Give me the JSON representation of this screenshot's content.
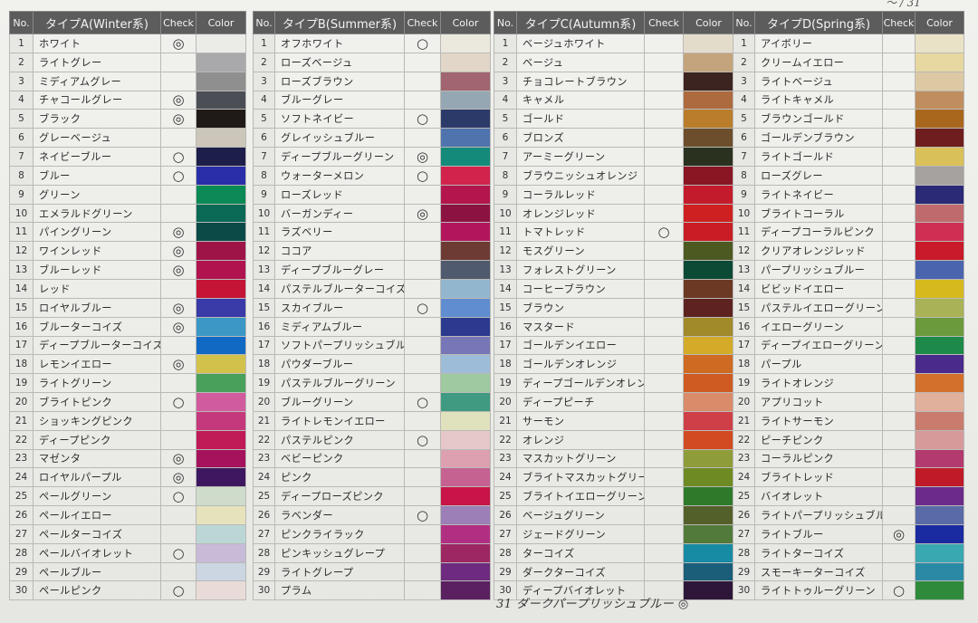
{
  "headers": {
    "no": "No.",
    "check": "Check",
    "color": "Color"
  },
  "tables": [
    {
      "title": "タイプA(Winter系)",
      "rows": [
        {
          "no": "1",
          "name": "ホワイト",
          "check": "◎",
          "color": "#ebebe8"
        },
        {
          "no": "2",
          "name": "ライトグレー",
          "check": "",
          "color": "#a9a9ab"
        },
        {
          "no": "3",
          "name": "ミディアムグレー",
          "check": "",
          "color": "#8f8f90"
        },
        {
          "no": "4",
          "name": "チャコールグレー",
          "check": "◎",
          "color": "#4b4e55"
        },
        {
          "no": "5",
          "name": "ブラック",
          "check": "◎",
          "color": "#1f1a18"
        },
        {
          "no": "6",
          "name": "グレーベージュ",
          "check": "",
          "color": "#cbc6b9"
        },
        {
          "no": "7",
          "name": "ネイビーブルー",
          "check": "○",
          "color": "#1d1e4a"
        },
        {
          "no": "8",
          "name": "ブルー",
          "check": "○",
          "color": "#2a2ea8"
        },
        {
          "no": "9",
          "name": "グリーン",
          "check": "",
          "color": "#0b8a55"
        },
        {
          "no": "10",
          "name": "エメラルドグリーン",
          "check": "",
          "color": "#0a6a55"
        },
        {
          "no": "11",
          "name": "パイングリーン",
          "check": "◎",
          "color": "#0a4a47"
        },
        {
          "no": "12",
          "name": "ワインレッド",
          "check": "◎",
          "color": "#9e1447"
        },
        {
          "no": "13",
          "name": "ブルーレッド",
          "check": "◎",
          "color": "#b0134e"
        },
        {
          "no": "14",
          "name": "レッド",
          "check": "",
          "color": "#c41536"
        },
        {
          "no": "15",
          "name": "ロイヤルブルー",
          "check": "◎",
          "color": "#3a3aa8"
        },
        {
          "no": "16",
          "name": "ブルーターコイズ",
          "check": "◎",
          "color": "#3b98c6"
        },
        {
          "no": "17",
          "name": "ディープブルーターコイズ",
          "check": "",
          "color": "#1269c4"
        },
        {
          "no": "18",
          "name": "レモンイエロー",
          "check": "◎",
          "color": "#d2c24c"
        },
        {
          "no": "19",
          "name": "ライトグリーン",
          "check": "",
          "color": "#49a05a"
        },
        {
          "no": "20",
          "name": "ブライトピンク",
          "check": "○",
          "color": "#d05c9e"
        },
        {
          "no": "21",
          "name": "ショッキングピンク",
          "check": "",
          "color": "#c4397b"
        },
        {
          "no": "22",
          "name": "ディープピンク",
          "check": "",
          "color": "#c01a57"
        },
        {
          "no": "23",
          "name": "マゼンタ",
          "check": "◎",
          "color": "#a4135c"
        },
        {
          "no": "24",
          "name": "ロイヤルパープル",
          "check": "◎",
          "color": "#3d1860"
        },
        {
          "no": "25",
          "name": "ペールグリーン",
          "check": "○",
          "color": "#cfdccc"
        },
        {
          "no": "26",
          "name": "ペールイエロー",
          "check": "",
          "color": "#e6e2bc"
        },
        {
          "no": "27",
          "name": "ペールターコイズ",
          "check": "",
          "color": "#bad7d6"
        },
        {
          "no": "28",
          "name": "ペールバイオレット",
          "check": "○",
          "color": "#c7bbd8"
        },
        {
          "no": "29",
          "name": "ペールブルー",
          "check": "",
          "color": "#cbd6e2"
        },
        {
          "no": "30",
          "name": "ペールピンク",
          "check": "○",
          "color": "#e9dcd8"
        }
      ]
    },
    {
      "title": "タイプB(Summer系)",
      "rows": [
        {
          "no": "1",
          "name": "オフホワイト",
          "check": "○",
          "color": "#ebe8de"
        },
        {
          "no": "2",
          "name": "ローズベージュ",
          "check": "",
          "color": "#e2d6c8"
        },
        {
          "no": "3",
          "name": "ローズブラウン",
          "check": "",
          "color": "#a0656f"
        },
        {
          "no": "4",
          "name": "ブルーグレー",
          "check": "",
          "color": "#95a7b3"
        },
        {
          "no": "5",
          "name": "ソフトネイビー",
          "check": "○",
          "color": "#2c3a6a"
        },
        {
          "no": "6",
          "name": "グレイッシュブルー",
          "check": "",
          "color": "#4f73ad"
        },
        {
          "no": "7",
          "name": "ディープブルーグリーン",
          "check": "◎",
          "color": "#138a7a"
        },
        {
          "no": "8",
          "name": "ウォーターメロン",
          "check": "○",
          "color": "#d2234d"
        },
        {
          "no": "9",
          "name": "ローズレッド",
          "check": "",
          "color": "#b3154c"
        },
        {
          "no": "10",
          "name": "バーガンディー",
          "check": "◎",
          "color": "#8c1242"
        },
        {
          "no": "11",
          "name": "ラズベリー",
          "check": "",
          "color": "#b2155c"
        },
        {
          "no": "12",
          "name": "ココア",
          "check": "",
          "color": "#6e3a34"
        },
        {
          "no": "13",
          "name": "ディープブルーグレー",
          "check": "",
          "color": "#4f5a6e"
        },
        {
          "no": "14",
          "name": "パステルブルーターコイズ",
          "check": "",
          "color": "#93b6cf"
        },
        {
          "no": "15",
          "name": "スカイブルー",
          "check": "○",
          "color": "#5f8dcf"
        },
        {
          "no": "16",
          "name": "ミディアムブルー",
          "check": "",
          "color": "#2b3a8e"
        },
        {
          "no": "17",
          "name": "ソフトパープリッシュブルー",
          "check": "",
          "color": "#7776b6"
        },
        {
          "no": "18",
          "name": "パウダーブルー",
          "check": "",
          "color": "#9dbcd8"
        },
        {
          "no": "19",
          "name": "パステルブルーグリーン",
          "check": "",
          "color": "#9fc99f"
        },
        {
          "no": "20",
          "name": "ブルーグリーン",
          "check": "○",
          "color": "#3f9a81"
        },
        {
          "no": "21",
          "name": "ライトレモンイエロー",
          "check": "",
          "color": "#e0e1bd"
        },
        {
          "no": "22",
          "name": "パステルピンク",
          "check": "○",
          "color": "#e6c8c8"
        },
        {
          "no": "23",
          "name": "ベビーピンク",
          "check": "",
          "color": "#dca0b1"
        },
        {
          "no": "24",
          "name": "ピンク",
          "check": "",
          "color": "#c56292"
        },
        {
          "no": "25",
          "name": "ディープローズピンク",
          "check": "",
          "color": "#c81447"
        },
        {
          "no": "26",
          "name": "ラベンダー",
          "check": "○",
          "color": "#9b7fb6"
        },
        {
          "no": "27",
          "name": "ピンクライラック",
          "check": "",
          "color": "#b12f82"
        },
        {
          "no": "28",
          "name": "ピンキッシュグレープ",
          "check": "",
          "color": "#9c2762"
        },
        {
          "no": "29",
          "name": "ライトグレープ",
          "check": "",
          "color": "#6e2a7e"
        },
        {
          "no": "30",
          "name": "プラム",
          "check": "",
          "color": "#5a2060"
        }
      ]
    },
    {
      "title": "タイプC(Autumn系)",
      "rows": [
        {
          "no": "1",
          "name": "ベージュホワイト",
          "check": "",
          "color": "#e4dccb"
        },
        {
          "no": "2",
          "name": "ベージュ",
          "check": "",
          "color": "#c4a47c"
        },
        {
          "no": "3",
          "name": "チョコレートブラウン",
          "check": "",
          "color": "#3c2420"
        },
        {
          "no": "4",
          "name": "キャメル",
          "check": "",
          "color": "#ad6a3e"
        },
        {
          "no": "5",
          "name": "ゴールド",
          "check": "",
          "color": "#b97d2c"
        },
        {
          "no": "6",
          "name": "ブロンズ",
          "check": "",
          "color": "#6d4e2c"
        },
        {
          "no": "7",
          "name": "アーミーグリーン",
          "check": "",
          "color": "#2a321f"
        },
        {
          "no": "8",
          "name": "ブラウニッシュオレンジ",
          "check": "",
          "color": "#8a1624"
        },
        {
          "no": "9",
          "name": "コーラルレッド",
          "check": "",
          "color": "#c41b2c"
        },
        {
          "no": "10",
          "name": "オレンジレッド",
          "check": "",
          "color": "#cf2021"
        },
        {
          "no": "11",
          "name": "トマトレッド",
          "check": "○",
          "color": "#c81d24"
        },
        {
          "no": "12",
          "name": "モスグリーン",
          "check": "",
          "color": "#4c5a21"
        },
        {
          "no": "13",
          "name": "フォレストグリーン",
          "check": "",
          "color": "#0d4a36"
        },
        {
          "no": "14",
          "name": "コーヒーブラウン",
          "check": "",
          "color": "#6c3a24"
        },
        {
          "no": "15",
          "name": "ブラウン",
          "check": "",
          "color": "#5e2320"
        },
        {
          "no": "16",
          "name": "マスタード",
          "check": "",
          "color": "#a08a2a"
        },
        {
          "no": "17",
          "name": "ゴールデンイエロー",
          "check": "",
          "color": "#d4ab28"
        },
        {
          "no": "18",
          "name": "ゴールデンオレンジ",
          "check": "",
          "color": "#cf6a22"
        },
        {
          "no": "19",
          "name": "ディープゴールデンオレンジ",
          "check": "",
          "color": "#cf5a22"
        },
        {
          "no": "20",
          "name": "ディープピーチ",
          "check": "",
          "color": "#d98b6a"
        },
        {
          "no": "21",
          "name": "サーモン",
          "check": "",
          "color": "#cf3f48"
        },
        {
          "no": "22",
          "name": "オレンジ",
          "check": "",
          "color": "#d24a22"
        },
        {
          "no": "23",
          "name": "マスカットグリーン",
          "check": "",
          "color": "#8e9c3a"
        },
        {
          "no": "24",
          "name": "ブライトマスカットグリーン",
          "check": "",
          "color": "#6e8a23"
        },
        {
          "no": "25",
          "name": "ブライトイエローグリーン",
          "check": "",
          "color": "#2d7a2a"
        },
        {
          "no": "26",
          "name": "ベージュグリーン",
          "check": "",
          "color": "#54602a"
        },
        {
          "no": "27",
          "name": "ジェードグリーン",
          "check": "",
          "color": "#527a3a"
        },
        {
          "no": "28",
          "name": "ターコイズ",
          "check": "",
          "color": "#178aa4"
        },
        {
          "no": "29",
          "name": "ダークターコイズ",
          "check": "",
          "color": "#1a5e7a"
        },
        {
          "no": "30",
          "name": "ディープバイオレット",
          "check": "",
          "color": "#2e1638"
        }
      ]
    },
    {
      "title": "タイプD(Spring系)",
      "rows": [
        {
          "no": "1",
          "name": "アイボリー",
          "check": "",
          "color": "#e9e2c6"
        },
        {
          "no": "2",
          "name": "クリームイエロー",
          "check": "",
          "color": "#e6d8a0"
        },
        {
          "no": "3",
          "name": "ライトベージュ",
          "check": "",
          "color": "#dcc9a4"
        },
        {
          "no": "4",
          "name": "ライトキャメル",
          "check": "",
          "color": "#c08e5e"
        },
        {
          "no": "5",
          "name": "ブラウンゴールド",
          "check": "",
          "color": "#a9671e"
        },
        {
          "no": "6",
          "name": "ゴールデンブラウン",
          "check": "",
          "color": "#6e1e1c"
        },
        {
          "no": "7",
          "name": "ライトゴールド",
          "check": "",
          "color": "#d9c058"
        },
        {
          "no": "8",
          "name": "ローズグレー",
          "check": "",
          "color": "#a5a2a0"
        },
        {
          "no": "9",
          "name": "ライトネイビー",
          "check": "",
          "color": "#2a2a76"
        },
        {
          "no": "10",
          "name": "ブライトコーラル",
          "check": "",
          "color": "#bf6b6e"
        },
        {
          "no": "11",
          "name": "ディープコーラルピンク",
          "check": "",
          "color": "#cf2f52"
        },
        {
          "no": "12",
          "name": "クリアオレンジレッド",
          "check": "",
          "color": "#c81a2a"
        },
        {
          "no": "13",
          "name": "パープリッシュブルー",
          "check": "",
          "color": "#4a64ae"
        },
        {
          "no": "14",
          "name": "ビビッドイエロー",
          "check": "",
          "color": "#d6b91c"
        },
        {
          "no": "15",
          "name": "パステルイエローグリーン",
          "check": "",
          "color": "#a9b257"
        },
        {
          "no": "16",
          "name": "イエローグリーン",
          "check": "",
          "color": "#6b9a3c"
        },
        {
          "no": "17",
          "name": "ディープイエローグリーン",
          "check": "",
          "color": "#1e8a4a"
        },
        {
          "no": "18",
          "name": "パープル",
          "check": "",
          "color": "#4a2a8a"
        },
        {
          "no": "19",
          "name": "ライトオレンジ",
          "check": "",
          "color": "#d2702c"
        },
        {
          "no": "20",
          "name": "アプリコット",
          "check": "",
          "color": "#e0b09c"
        },
        {
          "no": "21",
          "name": "ライトサーモン",
          "check": "",
          "color": "#c97c6e"
        },
        {
          "no": "22",
          "name": "ピーチピンク",
          "check": "",
          "color": "#d69a9a"
        },
        {
          "no": "23",
          "name": "コーラルピンク",
          "check": "",
          "color": "#b33a6e"
        },
        {
          "no": "24",
          "name": "ブライトレッド",
          "check": "",
          "color": "#c01928"
        },
        {
          "no": "25",
          "name": "バイオレット",
          "check": "",
          "color": "#6c2a8a"
        },
        {
          "no": "26",
          "name": "ライトパープリッシュブルー",
          "check": "",
          "color": "#5a6aa8"
        },
        {
          "no": "27",
          "name": "ライトブルー",
          "check": "◎",
          "color": "#1a2aa0"
        },
        {
          "no": "28",
          "name": "ライトターコイズ",
          "check": "",
          "color": "#3aa8b0"
        },
        {
          "no": "29",
          "name": "スモーキーターコイズ",
          "check": "",
          "color": "#2a8aa6"
        },
        {
          "no": "30",
          "name": "ライトトゥルーグリーン",
          "check": "○",
          "color": "#2f8a3c"
        }
      ]
    }
  ],
  "handwritten_note": "31 ダークパープリッシュブルー ◎",
  "corner_scribble": "〜 / 31"
}
